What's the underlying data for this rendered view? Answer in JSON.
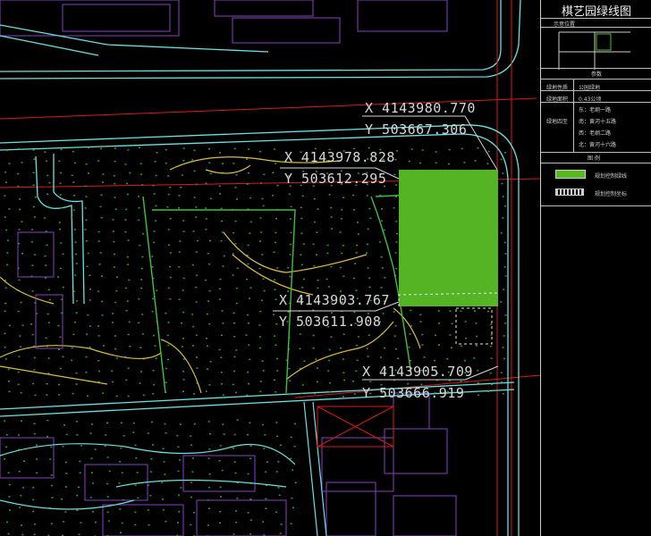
{
  "panel": {
    "title": "棋艺园绿线图",
    "location_label": "示意位置",
    "section_title": "参数",
    "rows": [
      {
        "key": "绿地性质",
        "value": "公园绿地"
      },
      {
        "key": "绿地面积",
        "value": "0.43公顷"
      },
      {
        "key": "",
        "value": "东：老纲一路"
      },
      {
        "key": "绿地四至",
        "value": "南：黄河十五路"
      },
      {
        "key": "",
        "value": "西：老纲二路"
      },
      {
        "key": "",
        "value": "北：黄河十六路"
      }
    ],
    "legend_title": "图  例",
    "legend": [
      {
        "label": "规划控制绿线",
        "color": "#55bb22"
      },
      {
        "label": "规划控制坐标"
      }
    ]
  },
  "coords": [
    {
      "x": "X  4143980.770",
      "y": "Y  503667.306"
    },
    {
      "x": "X  4143978.828",
      "y": "Y  503612.295"
    },
    {
      "x": "X  4143903.767",
      "y": "Y  503611.908"
    },
    {
      "x": "X  4143905.709",
      "y": "Y  503666.919"
    }
  ],
  "colors": {
    "green_area": "#55b423",
    "road_cyan": "#66e3e3",
    "boundary_red": "#e01818",
    "vegetation": "#2fa02f",
    "building": "#8a3fc4"
  }
}
